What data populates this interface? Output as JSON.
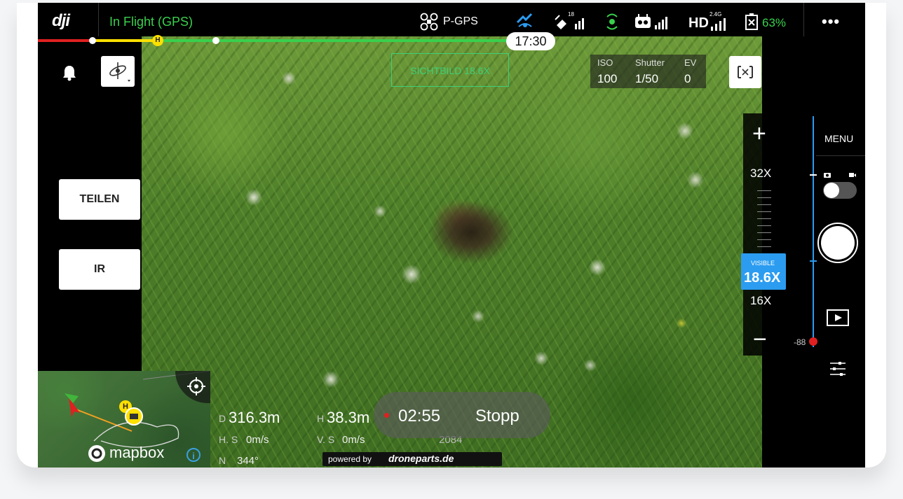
{
  "app": {
    "logo": "dji"
  },
  "status": {
    "flight_mode": "In Flight (GPS)",
    "gps_mode": "P-GPS",
    "satellites": "18",
    "link_label": "HD",
    "link_band": "2.4G",
    "battery": "63%",
    "more": "•••",
    "timer": "17:30"
  },
  "left": {
    "share_button": "TEILEN",
    "ir_button": "IR"
  },
  "camera": {
    "view_label": "SICHTBILD 18.6X",
    "iso_label": "ISO",
    "iso_value": "100",
    "shutter_label": "Shutter",
    "shutter_value": "1/50",
    "ev_label": "EV",
    "ev_value": "0",
    "ae_lock": "AE"
  },
  "zoom": {
    "plus": "+",
    "minus": "−",
    "max": "32X",
    "mode": "VISIBLE",
    "current": "18.6X",
    "min": "16X"
  },
  "right": {
    "menu": "MENU",
    "gimbal_value": "-88"
  },
  "telemetry": {
    "d_prefix": "D",
    "distance": "316.3m",
    "h_prefix": "H",
    "height": "38.3m",
    "hs_prefix": "H. S",
    "hspeed": "0m/s",
    "vs_prefix": "V. S",
    "vspeed": "0m/s",
    "heading_prefix": "N",
    "heading": "344°",
    "extra": "2084"
  },
  "recording": {
    "time": "02:55",
    "stop": "Stopp"
  },
  "map": {
    "brand": "mapbox",
    "home_marker": "H"
  },
  "watermark": {
    "prefix": "powered by",
    "brand": "droneparts.de"
  },
  "colors": {
    "flight_green": "#39d04c",
    "track_red": "#e02020",
    "track_yellow": "#ffe000",
    "track_green": "#39d04c",
    "zoom_blue": "#2b9cf0",
    "accent_cyan": "#3fd07a"
  }
}
